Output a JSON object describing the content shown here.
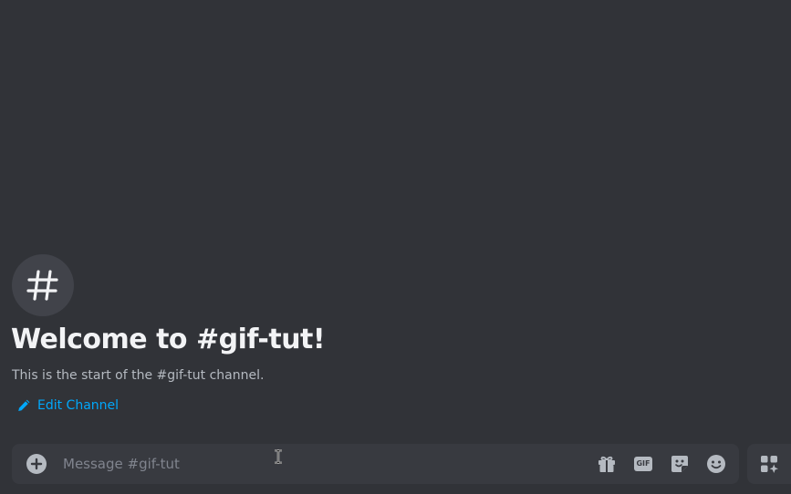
{
  "channel": {
    "welcome_title": "Welcome to #gif-tut!",
    "welcome_subtitle": "This is the start of the #gif-tut channel.",
    "edit_label": "Edit Channel",
    "hash_icon": "hash-icon"
  },
  "composer": {
    "placeholder": "Message #gif-tut",
    "value": "",
    "icons": [
      "plus-circle-icon",
      "gift-icon",
      "gif-icon",
      "sticker-icon",
      "emoji-icon",
      "app-launcher-icon"
    ],
    "gif_label": "GIF"
  },
  "colors": {
    "background": "#313338",
    "composer": "#383a40",
    "link": "#00a8fc",
    "title": "#f2f3f5",
    "muted": "#b5bac1"
  }
}
